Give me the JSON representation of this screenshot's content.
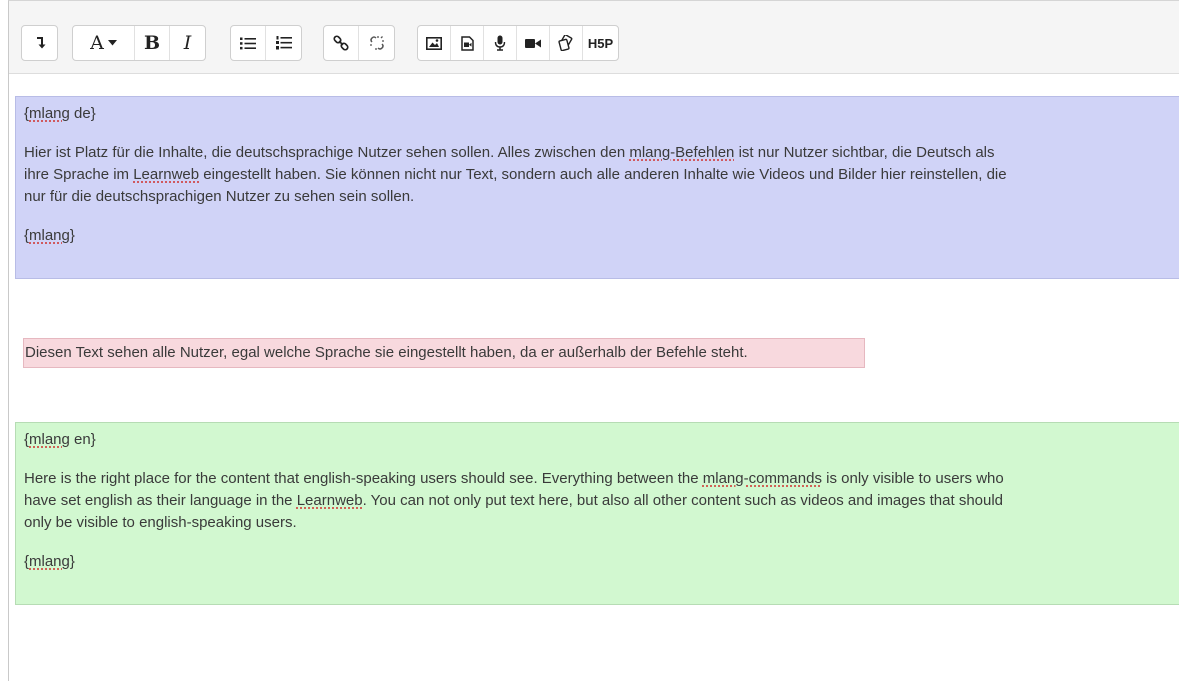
{
  "toolbar": {
    "groups": [
      [
        "collapse-icon"
      ],
      [
        "font-color-icon",
        "bold-icon",
        "italic-icon"
      ],
      [
        "unordered-list-icon",
        "ordered-list-icon"
      ],
      [
        "link-icon",
        "unlink-icon"
      ],
      [
        "image-icon",
        "media-icon",
        "record-audio-icon",
        "record-video-icon",
        "manage-files-icon",
        "h5p-icon"
      ]
    ],
    "font_color_label": "A",
    "bold_label": "B",
    "italic_label": "I",
    "h5p_label": "H5P"
  },
  "content": {
    "blocks": [
      {
        "color": "#d0d3f7",
        "open_tag_prefix": "{",
        "open_tag_word": "mlang",
        "open_tag_suffix": " de}",
        "line1a": "Hier ist Platz für die Inhalte, die deutschsprachige Nutzer sehen sollen. Alles zwischen den ",
        "line1_spell": "mlang-Befehlen",
        "line1b": " ist nur Nutzer sichtbar, die Deutsch als",
        "line2a": "ihre Sprache im ",
        "line2_spell": "Learnweb",
        "line2b": " eingestellt haben. Sie können nicht nur Text, sondern auch alle anderen Inhalte wie Videos und Bilder hier reinstellen, die",
        "line3": "nur für die deutschsprachigen Nutzer zu sehen sein sollen.",
        "close_tag_prefix": "{",
        "close_tag_word": "mlang",
        "close_tag_suffix": "}"
      },
      {
        "color": "#f8d9de",
        "text": "Diesen Text sehen alle Nutzer, egal welche Sprache sie eingestellt haben, da er außerhalb der Befehle steht."
      },
      {
        "color": "#d2f8d0",
        "open_tag_prefix": "{",
        "open_tag_word": "mlang",
        "open_tag_suffix": " en}",
        "line1a": "Here is the right place for the content that english-speaking users should see. Everything between the ",
        "line1_spell": "mlang-commands",
        "line1b": " is only visible to users who",
        "line2a": "have set english as their language in the ",
        "line2_spell": "Learnweb",
        "line2b": ". You can not only put text here, but also all other content such as videos and images that should",
        "line3": "only be visible to english-speaking users.",
        "close_tag_prefix": "{",
        "close_tag_word": "mlang",
        "close_tag_suffix": "}"
      }
    ]
  }
}
